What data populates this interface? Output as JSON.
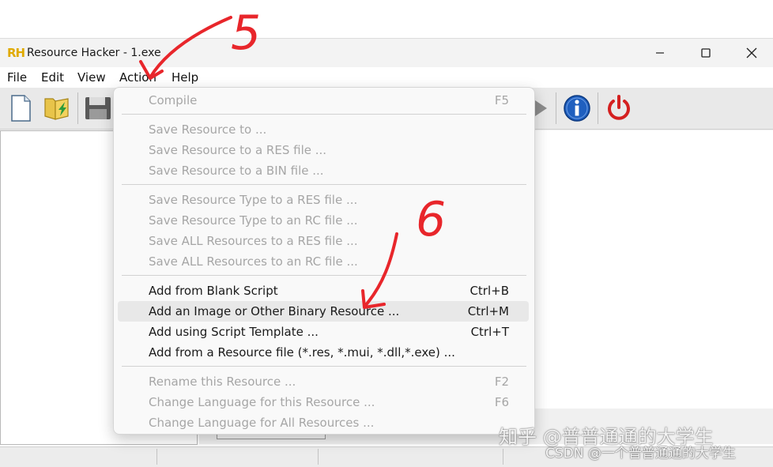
{
  "window": {
    "title": "Resource Hacker - 1.exe",
    "logo": "RH",
    "controls": [
      "minimize-icon",
      "maximize-icon",
      "close-icon"
    ]
  },
  "menubar": {
    "items": [
      "File",
      "Edit",
      "View",
      "Action",
      "Help"
    ]
  },
  "toolbar": {
    "buttons": [
      "new-file-icon",
      "open-folder-icon",
      "save-icon",
      "run-script-icon",
      "info-icon",
      "power-icon"
    ]
  },
  "action_menu": {
    "groups": [
      [
        {
          "label": "Compile",
          "shortcut": "F5",
          "enabled": false
        }
      ],
      [
        {
          "label": "Save Resource to ...",
          "shortcut": "",
          "enabled": false
        },
        {
          "label": "Save Resource to a RES file ...",
          "shortcut": "",
          "enabled": false
        },
        {
          "label": "Save Resource to a BIN file ...",
          "shortcut": "",
          "enabled": false
        }
      ],
      [
        {
          "label": "Save Resource Type to a RES file ...",
          "shortcut": "",
          "enabled": false
        },
        {
          "label": "Save Resource Type to an RC file ...",
          "shortcut": "",
          "enabled": false
        },
        {
          "label": "Save ALL Resources to a RES file ...",
          "shortcut": "",
          "enabled": false
        },
        {
          "label": "Save ALL Resources to an RC file ...",
          "shortcut": "",
          "enabled": false
        }
      ],
      [
        {
          "label": "Add from Blank Script",
          "shortcut": "Ctrl+B",
          "enabled": true
        },
        {
          "label": "Add an Image or Other Binary Resource ...",
          "shortcut": "Ctrl+M",
          "enabled": true,
          "highlighted": true
        },
        {
          "label": "Add using Script Template ...",
          "shortcut": "Ctrl+T",
          "enabled": true
        },
        {
          "label": "Add from a Resource file (*.res, *.mui, *.dll,*.exe) ...",
          "shortcut": "",
          "enabled": true
        }
      ],
      [
        {
          "label": "Rename this Resource ...",
          "shortcut": "F2",
          "enabled": false
        },
        {
          "label": "Change Language for this Resource ...",
          "shortcut": "F6",
          "enabled": false
        },
        {
          "label": "Change Language for All Resources ...",
          "shortcut": "",
          "enabled": false
        }
      ]
    ]
  },
  "annotations": {
    "step_5": "5",
    "step_6": "6",
    "color": "#e8262b"
  },
  "watermarks": {
    "zhihu": "知乎 @普普通通的大学生",
    "csdn": "CSDN @一个普普通通的大学生"
  },
  "colors": {
    "disabled_text": "#a6a6a6",
    "enabled_text": "#1a1a1a",
    "hover_bg": "#e8e8e8",
    "info_blue": "#1f5fbf",
    "power_red": "#d42020"
  }
}
